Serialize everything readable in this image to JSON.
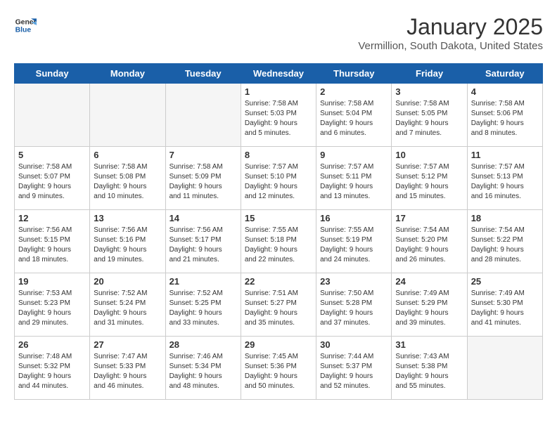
{
  "logo": {
    "line1": "General",
    "line2": "Blue"
  },
  "title": "January 2025",
  "subtitle": "Vermillion, South Dakota, United States",
  "days_of_week": [
    "Sunday",
    "Monday",
    "Tuesday",
    "Wednesday",
    "Thursday",
    "Friday",
    "Saturday"
  ],
  "weeks": [
    [
      {
        "day": "",
        "content": ""
      },
      {
        "day": "",
        "content": ""
      },
      {
        "day": "",
        "content": ""
      },
      {
        "day": "1",
        "content": "Sunrise: 7:58 AM\nSunset: 5:03 PM\nDaylight: 9 hours\nand 5 minutes."
      },
      {
        "day": "2",
        "content": "Sunrise: 7:58 AM\nSunset: 5:04 PM\nDaylight: 9 hours\nand 6 minutes."
      },
      {
        "day": "3",
        "content": "Sunrise: 7:58 AM\nSunset: 5:05 PM\nDaylight: 9 hours\nand 7 minutes."
      },
      {
        "day": "4",
        "content": "Sunrise: 7:58 AM\nSunset: 5:06 PM\nDaylight: 9 hours\nand 8 minutes."
      }
    ],
    [
      {
        "day": "5",
        "content": "Sunrise: 7:58 AM\nSunset: 5:07 PM\nDaylight: 9 hours\nand 9 minutes."
      },
      {
        "day": "6",
        "content": "Sunrise: 7:58 AM\nSunset: 5:08 PM\nDaylight: 9 hours\nand 10 minutes."
      },
      {
        "day": "7",
        "content": "Sunrise: 7:58 AM\nSunset: 5:09 PM\nDaylight: 9 hours\nand 11 minutes."
      },
      {
        "day": "8",
        "content": "Sunrise: 7:57 AM\nSunset: 5:10 PM\nDaylight: 9 hours\nand 12 minutes."
      },
      {
        "day": "9",
        "content": "Sunrise: 7:57 AM\nSunset: 5:11 PM\nDaylight: 9 hours\nand 13 minutes."
      },
      {
        "day": "10",
        "content": "Sunrise: 7:57 AM\nSunset: 5:12 PM\nDaylight: 9 hours\nand 15 minutes."
      },
      {
        "day": "11",
        "content": "Sunrise: 7:57 AM\nSunset: 5:13 PM\nDaylight: 9 hours\nand 16 minutes."
      }
    ],
    [
      {
        "day": "12",
        "content": "Sunrise: 7:56 AM\nSunset: 5:15 PM\nDaylight: 9 hours\nand 18 minutes."
      },
      {
        "day": "13",
        "content": "Sunrise: 7:56 AM\nSunset: 5:16 PM\nDaylight: 9 hours\nand 19 minutes."
      },
      {
        "day": "14",
        "content": "Sunrise: 7:56 AM\nSunset: 5:17 PM\nDaylight: 9 hours\nand 21 minutes."
      },
      {
        "day": "15",
        "content": "Sunrise: 7:55 AM\nSunset: 5:18 PM\nDaylight: 9 hours\nand 22 minutes."
      },
      {
        "day": "16",
        "content": "Sunrise: 7:55 AM\nSunset: 5:19 PM\nDaylight: 9 hours\nand 24 minutes."
      },
      {
        "day": "17",
        "content": "Sunrise: 7:54 AM\nSunset: 5:20 PM\nDaylight: 9 hours\nand 26 minutes."
      },
      {
        "day": "18",
        "content": "Sunrise: 7:54 AM\nSunset: 5:22 PM\nDaylight: 9 hours\nand 28 minutes."
      }
    ],
    [
      {
        "day": "19",
        "content": "Sunrise: 7:53 AM\nSunset: 5:23 PM\nDaylight: 9 hours\nand 29 minutes."
      },
      {
        "day": "20",
        "content": "Sunrise: 7:52 AM\nSunset: 5:24 PM\nDaylight: 9 hours\nand 31 minutes."
      },
      {
        "day": "21",
        "content": "Sunrise: 7:52 AM\nSunset: 5:25 PM\nDaylight: 9 hours\nand 33 minutes."
      },
      {
        "day": "22",
        "content": "Sunrise: 7:51 AM\nSunset: 5:27 PM\nDaylight: 9 hours\nand 35 minutes."
      },
      {
        "day": "23",
        "content": "Sunrise: 7:50 AM\nSunset: 5:28 PM\nDaylight: 9 hours\nand 37 minutes."
      },
      {
        "day": "24",
        "content": "Sunrise: 7:49 AM\nSunset: 5:29 PM\nDaylight: 9 hours\nand 39 minutes."
      },
      {
        "day": "25",
        "content": "Sunrise: 7:49 AM\nSunset: 5:30 PM\nDaylight: 9 hours\nand 41 minutes."
      }
    ],
    [
      {
        "day": "26",
        "content": "Sunrise: 7:48 AM\nSunset: 5:32 PM\nDaylight: 9 hours\nand 44 minutes."
      },
      {
        "day": "27",
        "content": "Sunrise: 7:47 AM\nSunset: 5:33 PM\nDaylight: 9 hours\nand 46 minutes."
      },
      {
        "day": "28",
        "content": "Sunrise: 7:46 AM\nSunset: 5:34 PM\nDaylight: 9 hours\nand 48 minutes."
      },
      {
        "day": "29",
        "content": "Sunrise: 7:45 AM\nSunset: 5:36 PM\nDaylight: 9 hours\nand 50 minutes."
      },
      {
        "day": "30",
        "content": "Sunrise: 7:44 AM\nSunset: 5:37 PM\nDaylight: 9 hours\nand 52 minutes."
      },
      {
        "day": "31",
        "content": "Sunrise: 7:43 AM\nSunset: 5:38 PM\nDaylight: 9 hours\nand 55 minutes."
      },
      {
        "day": "",
        "content": ""
      }
    ]
  ]
}
